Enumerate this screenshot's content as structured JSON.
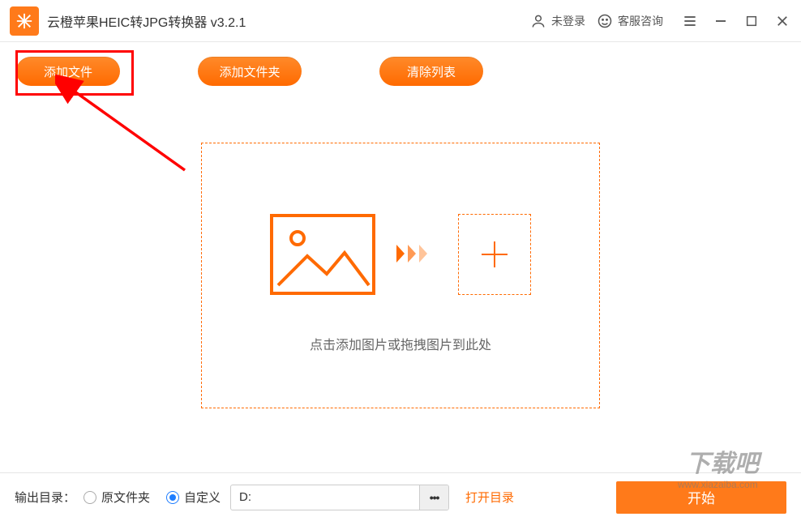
{
  "titlebar": {
    "app_title": "云橙苹果HEIC转JPG转换器 v3.2.1",
    "login_status": "未登录",
    "support_label": "客服咨询"
  },
  "toolbar": {
    "add_file_label": "添加文件",
    "add_folder_label": "添加文件夹",
    "clear_list_label": "清除列表"
  },
  "dropzone": {
    "hint_text": "点击添加图片或拖拽图片到此处"
  },
  "bottombar": {
    "output_label": "输出目录：",
    "radio_original": "原文件夹",
    "radio_custom": "自定义",
    "path_value": "D:",
    "browse_dots": "•••",
    "open_link": "打开目录",
    "start_label": "开始",
    "selected_radio": "custom"
  },
  "watermark": {
    "text_main": "下载吧",
    "text_url": "www.xiazaiba.com"
  },
  "colors": {
    "accent": "#ff6a00",
    "highlight_red": "#ff0000"
  }
}
